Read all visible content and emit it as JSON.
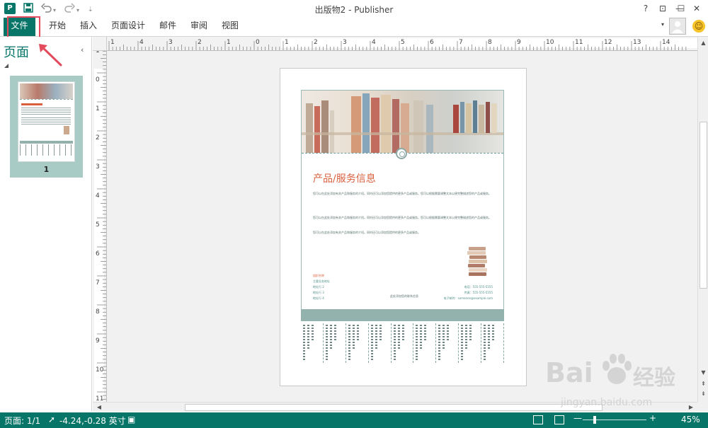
{
  "window": {
    "title": "出版物2 - Publisher",
    "app_icon_letter": "P",
    "help": "?",
    "ribbon_toggle": "⊡",
    "minimize": "—",
    "maximize": "☐",
    "close": "✕"
  },
  "quick_access": {
    "save_icon": "save-icon",
    "undo_icon": "undo-icon",
    "redo_icon": "redo-icon"
  },
  "ribbon": {
    "tabs": [
      "文件",
      "开始",
      "插入",
      "页面设计",
      "邮件",
      "审阅",
      "视图"
    ]
  },
  "pages_panel": {
    "title": "页面",
    "collapse": "‹",
    "thumbnail_number": "1"
  },
  "rulers": {
    "horizontal_labels": [
      "1",
      "4",
      "3",
      "2",
      "1",
      "0",
      "1",
      "2",
      "3",
      "4",
      "5",
      "6",
      "7",
      "8",
      "9",
      "10",
      "11",
      "12",
      "13",
      "14"
    ],
    "vertical_labels": [
      "1",
      "0",
      "1",
      "2",
      "3",
      "4",
      "5",
      "6",
      "7",
      "8",
      "9",
      "10",
      "11"
    ]
  },
  "flyer": {
    "heading": "产品/服务信息",
    "paragraphs": [
      "您可以在此处添加有关产品和服务的介绍。同时还可以添加您提供的更多产品或服务。您可以根据需要调整文本以便完整描述您的产品或服务。",
      "您可以在此处添加有关产品和服务的介绍。同时还可以添加您提供的更多产品或服务。您可以根据需要调整文本以便完整描述您的产品或服务。",
      "您可以在此处添加有关产品和服务的介绍。同时还可以添加您提供的更多产品或服务。"
    ],
    "contact_left": [
      "组织名称",
      "主要业务地址",
      "地址行 2",
      "地址行 3",
      "地址行 4"
    ],
    "contact_mid": "此处添加您的联系信息",
    "contact_right": [
      "电话：555-555-5555",
      "传真：555-555-5555",
      "电子邮件：someone@example.com"
    ],
    "tear_tab_count": 9
  },
  "status": {
    "page": "页面: 1/1",
    "position": "-4.24,-0.28 英寸",
    "zoom": "45%",
    "zoom_minus": "—",
    "zoom_plus": "+"
  },
  "watermark": {
    "brand": "Bai",
    "brand_cn": "经验",
    "url": "jingyan.baidu.com"
  },
  "colors": {
    "accent": "#077568",
    "highlight_box": "#e24b5b",
    "flyer_heading": "#d9603f",
    "flyer_band": "#93b2ae"
  }
}
